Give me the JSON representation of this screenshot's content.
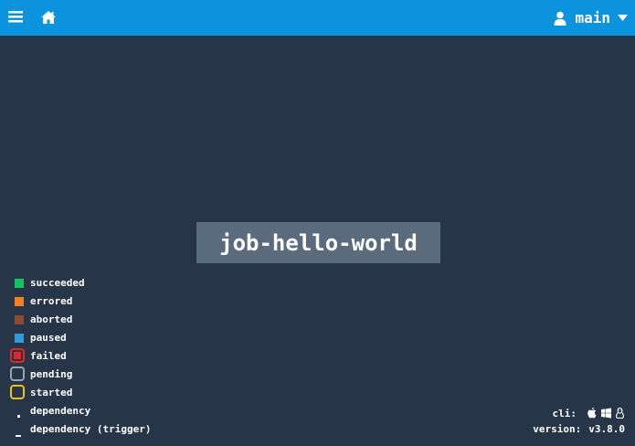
{
  "header": {
    "background_color": "#0c93dd",
    "menu_icon": "hamburger-icon",
    "home_icon": "home-icon",
    "user": {
      "icon": "user-icon",
      "name": "main",
      "dropdown_icon": "caret-down-icon"
    }
  },
  "canvas": {
    "background_color": "#263548",
    "job_node": {
      "label": "job-hello-world",
      "background_color": "#5a6b7e"
    }
  },
  "legend": {
    "items": [
      {
        "label": "succeeded",
        "color": "#11c560"
      },
      {
        "label": "errored",
        "color": "#f5811e"
      },
      {
        "label": "aborted",
        "color": "#8f4b2d"
      },
      {
        "label": "paused",
        "color": "#3498db"
      },
      {
        "label": "failed",
        "color": "#e4252a"
      },
      {
        "label": "pending",
        "color": "#9aa5b1"
      },
      {
        "label": "started",
        "color": "#f0c108"
      },
      {
        "label": "dependency"
      },
      {
        "label": "dependency (trigger)"
      }
    ]
  },
  "footer": {
    "cli_label": "cli:",
    "cli_icons": [
      "apple-icon",
      "windows-icon",
      "linux-icon"
    ],
    "version_label": "version:",
    "version_value": "v3.8.0"
  }
}
